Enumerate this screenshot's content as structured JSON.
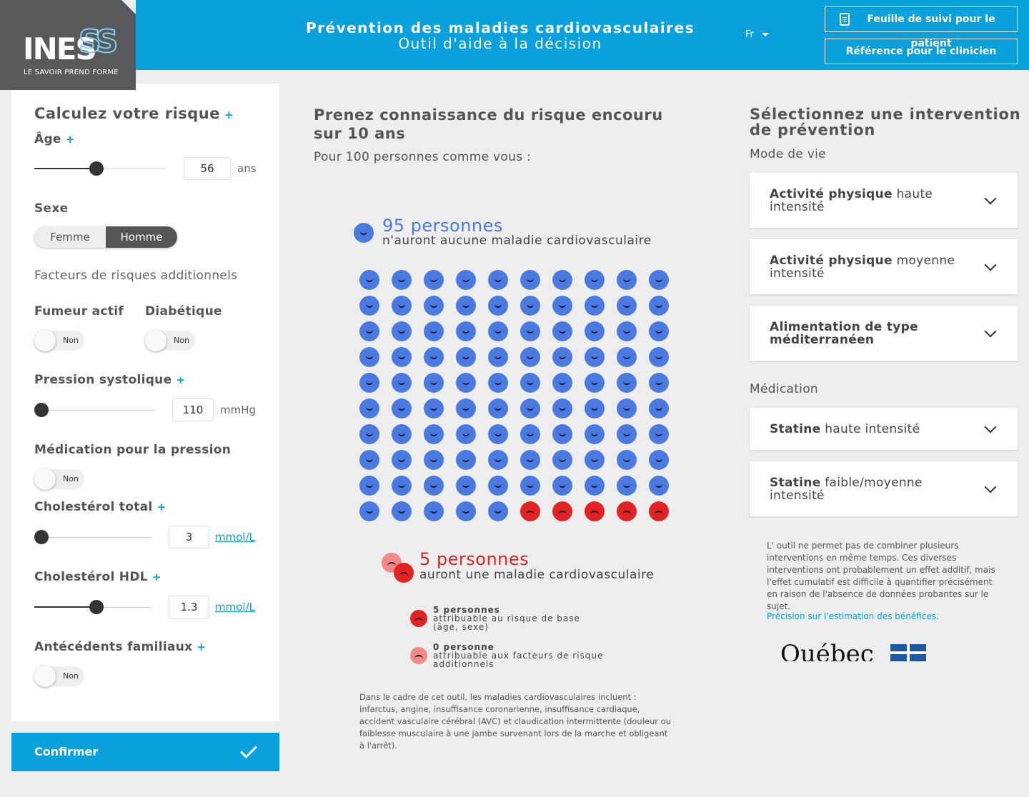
{
  "header": {
    "logo_text": "INES",
    "logo_ss": "SS",
    "logo_tagline": "LE SAVOIR PREND FORME",
    "title": "Prévention des maladies cardiovasculaires",
    "subtitle": "Outil d'aide à la décision",
    "language": "Fr",
    "patient_sheet_button": "Feuille de suivi pour le patient",
    "clinician_ref_button": "Référence pour le clinicien"
  },
  "risk_form": {
    "title": "Calculez votre risque",
    "plus": "+",
    "age": {
      "label": "Âge",
      "value": "56",
      "unit": "ans",
      "slider_fraction": 0.47
    },
    "sex": {
      "label": "Sexe",
      "options": [
        "Femme",
        "Homme"
      ],
      "selected": "Homme"
    },
    "additional_factors_heading": "Facteurs de risques additionnels",
    "smoker": {
      "label": "Fumeur actif",
      "state": "Non"
    },
    "diabetic": {
      "label": "Diabétique",
      "state": "Non"
    },
    "systolic": {
      "label": "Pression systolique",
      "value": "110",
      "unit": "mmHg",
      "slider_fraction": 0.0
    },
    "bp_medication": {
      "label": "Médication pour la pression",
      "state": "Non"
    },
    "total_chol": {
      "label": "Cholestérol total",
      "value": "3",
      "unit": "mmol/L",
      "slider_fraction": 0.0
    },
    "hdl_chol": {
      "label": "Cholestérol HDL",
      "value": "1.3",
      "unit": "mmol/L",
      "slider_fraction": 0.53
    },
    "family_history": {
      "label": "Antécédents familiaux",
      "state": "Non"
    },
    "confirm_button": "Confirmer"
  },
  "risk_display": {
    "title": "Prenez connaissance du risque encouru sur 10 ans",
    "subtitle": "Pour 100 personnes comme vous :",
    "healthy_count_text": "95 personnes",
    "healthy_desc": "n'auront aucune maladie cardiovasculaire",
    "sick_count_text": "5 personnes",
    "sick_desc": "auront une maladie cardiovasculaire",
    "base_risk_title": "5 personnes",
    "base_risk_desc": "attribuable au risque de base (âge, sexe)",
    "additional_risk_title": "0 personne",
    "additional_risk_desc": "attribuable aux facteurs de risque additionnels",
    "grid": {
      "total": 100,
      "healthy": 95,
      "base_risk": 5,
      "additional_risk": 0
    },
    "footnote": "Dans le cadre de cet outil, les maladies cardiovasculaires incluent : infarctus, angine, insuffisance coronarienne, insuffisance cardiaque, accident vasculaire cérébral (AVC) et claudication intermittente (douleur ou faiblesse musculaire à une jambe survenant lors de la marche et obligeant à l'arrêt).",
    "colors": {
      "healthy": "#4a7adf",
      "base_risk": "#e02424",
      "additional_risk": "#f28a8a"
    }
  },
  "interventions": {
    "title": "Sélectionnez une intervention de prévention",
    "lifestyle_heading": "Mode de vie",
    "lifestyle": [
      {
        "bold": "Activité physique",
        "rest": " haute intensité"
      },
      {
        "bold": "Activité physique",
        "rest": " moyenne intensité"
      },
      {
        "bold": "Alimentation de type méditerranéen",
        "rest": ""
      }
    ],
    "medication_heading": "Médication",
    "medication": [
      {
        "bold": "Statine",
        "rest": " haute intensité"
      },
      {
        "bold": "Statine",
        "rest": " faible/moyenne intensité"
      }
    ],
    "note": "L' outil ne permet  pas de combiner plusieurs interventions en même temps. Ces diverses interventions ont probablement un effet additif, mais l'effet cumulatif  est difficile à quantifier précisément en raison de l'absence de données probantes sur le sujet.",
    "benefits_link": "Précision sur l'estimation des bénéfices.",
    "quebec_logo": "Québec"
  },
  "accent_color": "#0aa0dc"
}
